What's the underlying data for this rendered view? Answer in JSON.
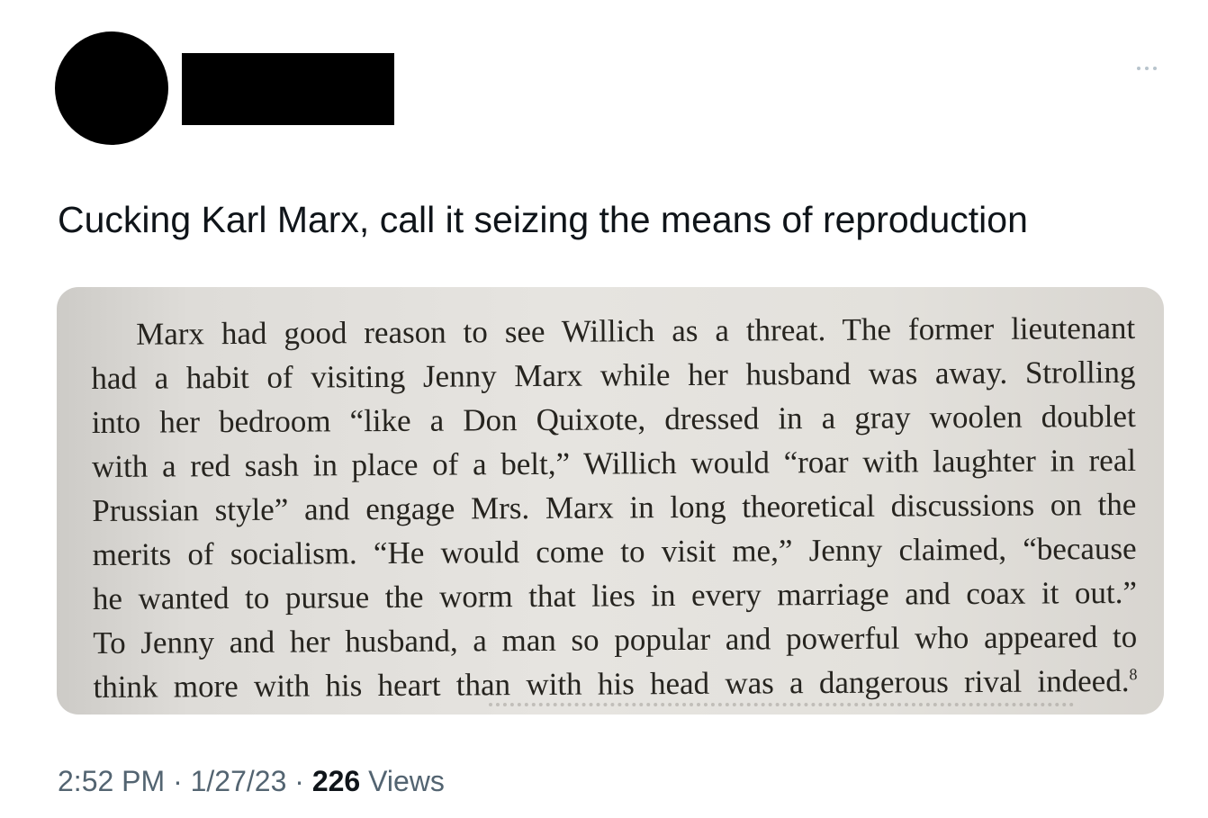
{
  "tweet": {
    "more_icon": "more-horizontal-icon",
    "text": "Cucking Karl Marx, call it seizing the means of reproduction",
    "media": {
      "lines": [
        "Marx had good reason to see Willich as a threat. The former lieutenant",
        "had a habit of visiting Jenny Marx while her husband was away. Strolling",
        "into her bedroom “like a Don Quixote, dressed in a gray woolen doublet",
        "with a red sash in place of a belt,” Willich would “roar with laughter in real",
        "Prussian style” and engage Mrs. Marx in long theoretical discussions on the",
        "merits of socialism. “He would come to visit me,” Jenny claimed, “because",
        "he wanted to pursue the worm that lies in every marriage and coax it out.”",
        "To Jenny and her husband, a man so popular and powerful who appeared to",
        "think more with his heart than with his head was a dangerous rival indeed."
      ],
      "footnote": "8"
    },
    "time": "2:52 PM",
    "date": "1/27/23",
    "separator": "·",
    "views_count": "226",
    "views_label": "Views"
  }
}
